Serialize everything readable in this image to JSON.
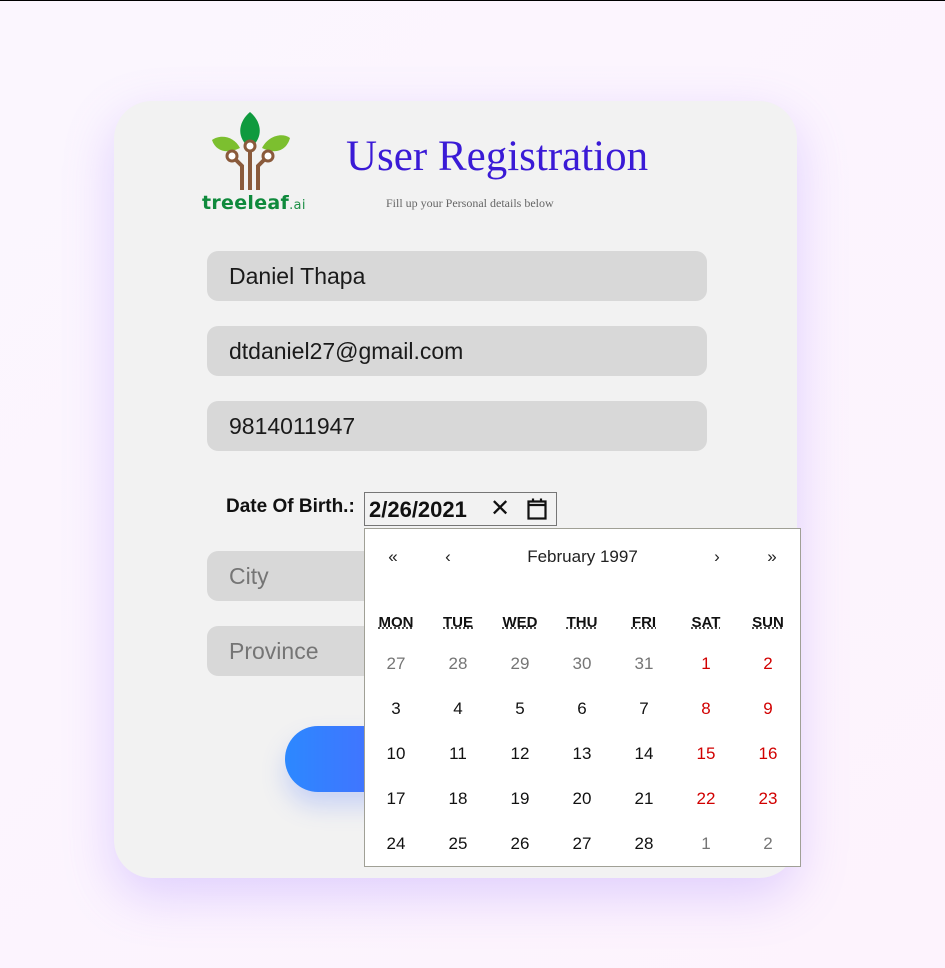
{
  "header": {
    "logo_name": "treeleaf",
    "logo_suffix": ".ai",
    "title": "User Registration",
    "subtitle": "Fill up your Personal details below"
  },
  "form": {
    "name_value": "Daniel Thapa",
    "email_value": "dtdaniel27@gmail.com",
    "phone_value": "9814011947",
    "dob_label": "Date Of Birth.:",
    "dob_value": "2/26/2021",
    "city_placeholder": "City",
    "province_placeholder": "Province"
  },
  "calendar": {
    "prev_year": "«",
    "prev_month": "‹",
    "month_label": "February 1997",
    "next_month": "›",
    "next_year": "»",
    "weekdays": [
      "MON",
      "TUE",
      "WED",
      "THU",
      "FRI",
      "SAT",
      "SUN"
    ],
    "weeks": [
      [
        {
          "d": "27",
          "t": "neighbor"
        },
        {
          "d": "28",
          "t": "neighbor"
        },
        {
          "d": "29",
          "t": "neighbor"
        },
        {
          "d": "30",
          "t": "neighbor"
        },
        {
          "d": "31",
          "t": "neighbor"
        },
        {
          "d": "1",
          "t": "weekend"
        },
        {
          "d": "2",
          "t": "weekend"
        }
      ],
      [
        {
          "d": "3",
          "t": ""
        },
        {
          "d": "4",
          "t": ""
        },
        {
          "d": "5",
          "t": ""
        },
        {
          "d": "6",
          "t": ""
        },
        {
          "d": "7",
          "t": ""
        },
        {
          "d": "8",
          "t": "weekend"
        },
        {
          "d": "9",
          "t": "weekend"
        }
      ],
      [
        {
          "d": "10",
          "t": ""
        },
        {
          "d": "11",
          "t": ""
        },
        {
          "d": "12",
          "t": ""
        },
        {
          "d": "13",
          "t": ""
        },
        {
          "d": "14",
          "t": ""
        },
        {
          "d": "15",
          "t": "weekend"
        },
        {
          "d": "16",
          "t": "weekend"
        }
      ],
      [
        {
          "d": "17",
          "t": ""
        },
        {
          "d": "18",
          "t": ""
        },
        {
          "d": "19",
          "t": ""
        },
        {
          "d": "20",
          "t": ""
        },
        {
          "d": "21",
          "t": ""
        },
        {
          "d": "22",
          "t": "weekend"
        },
        {
          "d": "23",
          "t": "weekend"
        }
      ],
      [
        {
          "d": "24",
          "t": ""
        },
        {
          "d": "25",
          "t": ""
        },
        {
          "d": "26",
          "t": ""
        },
        {
          "d": "27",
          "t": ""
        },
        {
          "d": "28",
          "t": ""
        },
        {
          "d": "1",
          "t": "neighbor"
        },
        {
          "d": "2",
          "t": "neighbor"
        }
      ]
    ]
  },
  "colors": {
    "title": "#3a1ad6",
    "weekend": "#d10000",
    "button_gradient_start": "#2c88ff",
    "button_gradient_end": "#4a6cff"
  }
}
